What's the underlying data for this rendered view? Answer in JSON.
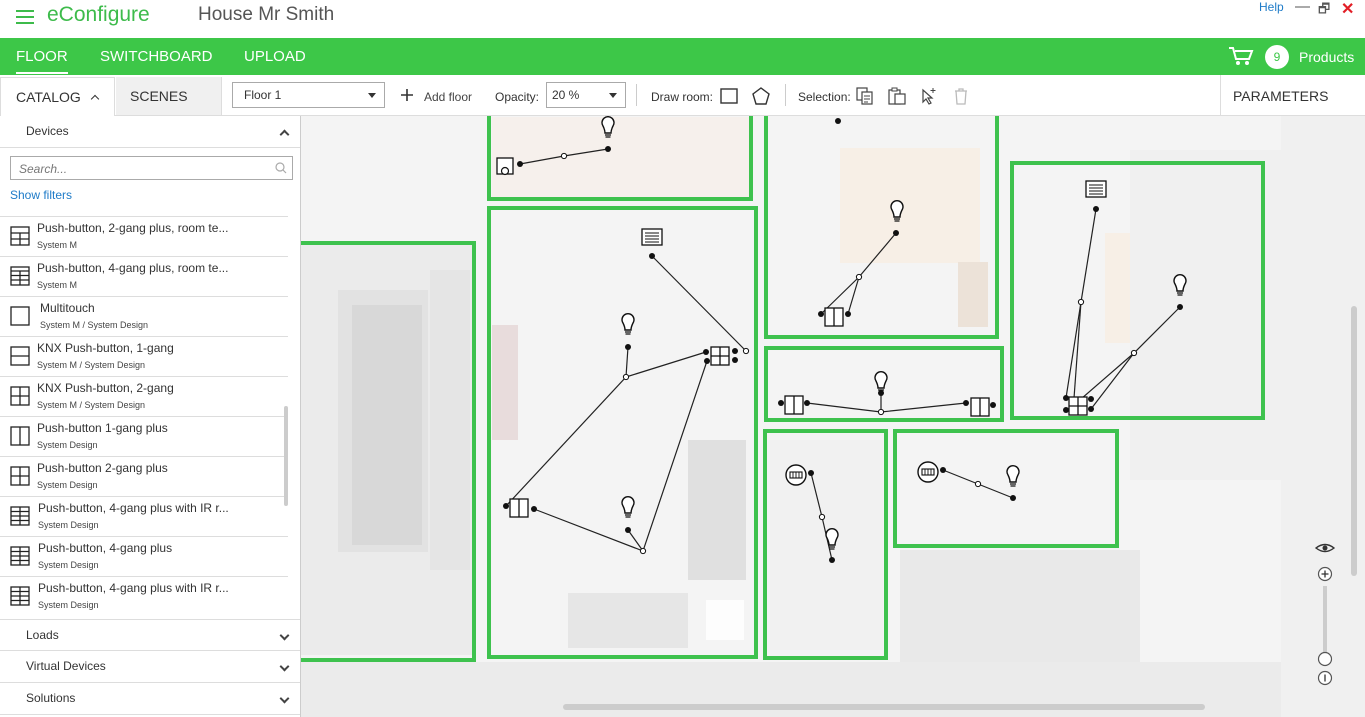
{
  "app": {
    "name": "eConfigure",
    "project": "House Mr Smith",
    "help": "Help",
    "min": "—",
    "restore": "🗗",
    "close": "✕"
  },
  "nav": {
    "tabs": [
      "FLOOR",
      "SWITCHBOARD",
      "UPLOAD"
    ],
    "cart_count": "9",
    "products": "Products"
  },
  "toolbar": {
    "catalog": "CATALOG",
    "scenes": "SCENES",
    "floor": "Floor 1",
    "add_floor": "Add floor",
    "opacity_label": "Opacity:",
    "opacity_value": "20 %",
    "draw_room": "Draw room:",
    "selection": "Selection:",
    "parameters": "PARAMETERS"
  },
  "sidebar": {
    "devices": "Devices",
    "search_placeholder": "Search...",
    "show_filters": "Show filters",
    "items": [
      {
        "name": "Push-button, 2-gang plus, room te...",
        "sub": "System M",
        "icon": "grid-2x2-panel-icon"
      },
      {
        "name": "Push-button, 4-gang plus, room te...",
        "sub": "System M",
        "icon": "grid-4x2-panel-icon"
      },
      {
        "name": "Multitouch",
        "sub": "System M / System Design",
        "icon": "square-icon"
      },
      {
        "name": "KNX Push-button, 1-gang",
        "sub": "System M / System Design",
        "icon": "horizontal-split-icon"
      },
      {
        "name": "KNX Push-button, 2-gang",
        "sub": "System M / System Design",
        "icon": "quad-split-icon"
      },
      {
        "name": "Push-button 1-gang plus",
        "sub": "System Design",
        "icon": "vertical-split-icon"
      },
      {
        "name": "Push-button 2-gang plus",
        "sub": "System Design",
        "icon": "quad-split-icon"
      },
      {
        "name": "Push-button, 4-gang plus with IR r...",
        "sub": "System Design",
        "icon": "grid-4x2-icon"
      },
      {
        "name": "Push-button, 4-gang plus",
        "sub": "System Design",
        "icon": "grid-4x2-icon"
      },
      {
        "name": "Push-button, 4-gang plus with IR r...",
        "sub": "System Design",
        "icon": "grid-4x2-icon"
      }
    ],
    "sections": [
      "Loads",
      "Virtual Devices",
      "Solutions"
    ]
  },
  "colors": {
    "brand_green": "#3dc748",
    "room_border": "#3ec24e",
    "link_blue": "#1e7bc8"
  }
}
